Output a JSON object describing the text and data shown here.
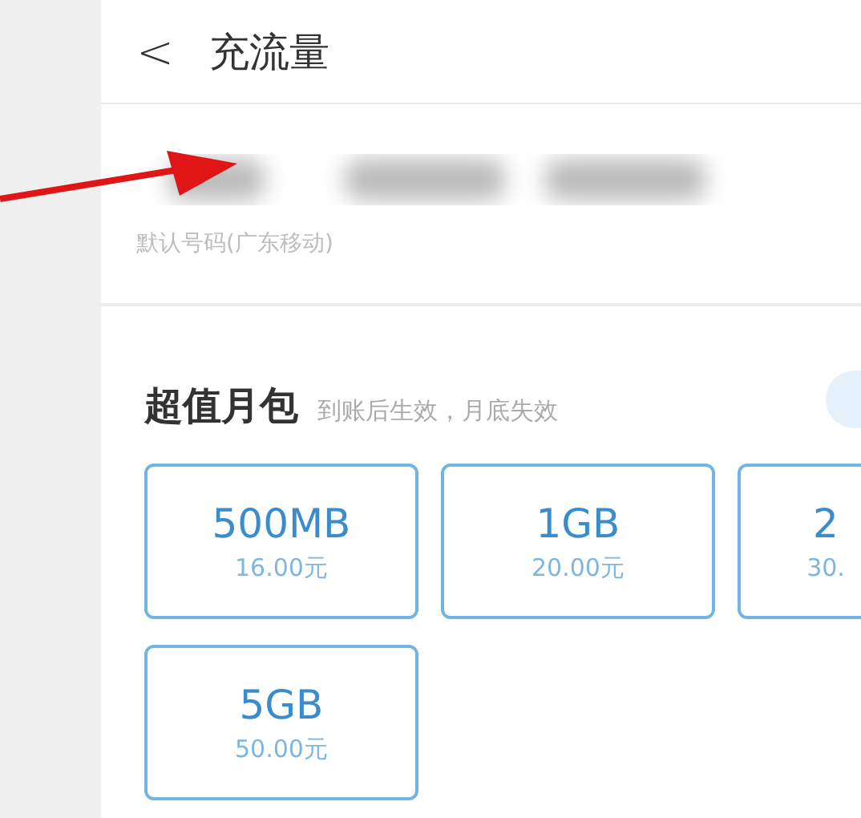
{
  "header": {
    "back": "<",
    "title": "充流量"
  },
  "account": {
    "label": "默认号码(广东移动)"
  },
  "section": {
    "title": "超值月包",
    "note": "到账后生效，月底失效"
  },
  "packages": [
    {
      "size": "500MB",
      "price": "16.00元"
    },
    {
      "size": "1GB",
      "price": "20.00元"
    },
    {
      "size": "2",
      "price": "30."
    },
    {
      "size": "5GB",
      "price": "50.00元"
    }
  ]
}
